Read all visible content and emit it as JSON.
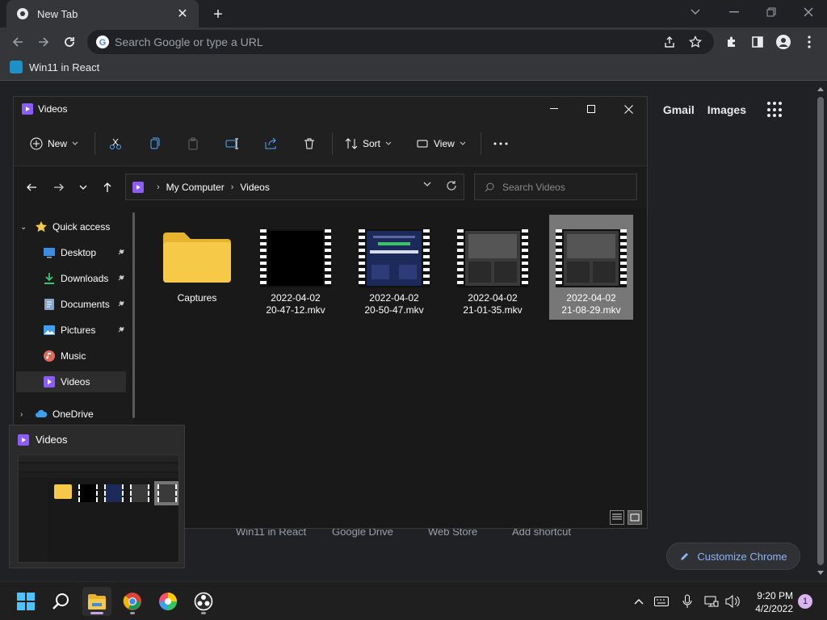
{
  "chrome": {
    "tab_title": "New Tab",
    "omnibox_placeholder": "Search Google or type a URL",
    "bookmark": "Win11 in React",
    "ntp_links": {
      "gmail": "Gmail",
      "images": "Images"
    },
    "shortcuts": [
      "Win11 in React",
      "Google Drive",
      "Web Store",
      "Add shortcut"
    ],
    "customize": "Customize Chrome"
  },
  "explorer": {
    "title": "Videos",
    "ribbon": {
      "new": "New",
      "sort": "Sort",
      "view": "View"
    },
    "breadcrumb": [
      "My Computer",
      "Videos"
    ],
    "search_placeholder": "Search Videos",
    "nav": {
      "quick_access": "Quick access",
      "items": [
        "Desktop",
        "Downloads",
        "Documents",
        "Pictures",
        "Music",
        "Videos"
      ],
      "onedrive": "OneDrive"
    },
    "files": [
      {
        "name": "Captures",
        "type": "folder"
      },
      {
        "name": "2022-04-02\n20-47-12.mkv",
        "type": "video"
      },
      {
        "name": "2022-04-02\n20-50-47.mkv",
        "type": "video"
      },
      {
        "name": "2022-04-02\n21-01-35.mkv",
        "type": "video"
      },
      {
        "name": "2022-04-02\n21-08-29.mkv",
        "type": "video"
      }
    ]
  },
  "preview": {
    "title": "Videos"
  },
  "taskbar": {
    "time": "9:20 PM",
    "date": "4/2/2022",
    "notifications": "1"
  },
  "colors": {
    "accent_purple": "#8b5cf6",
    "folder_yellow": "#f7c948",
    "chrome_link_blue": "#8ab4f8"
  }
}
